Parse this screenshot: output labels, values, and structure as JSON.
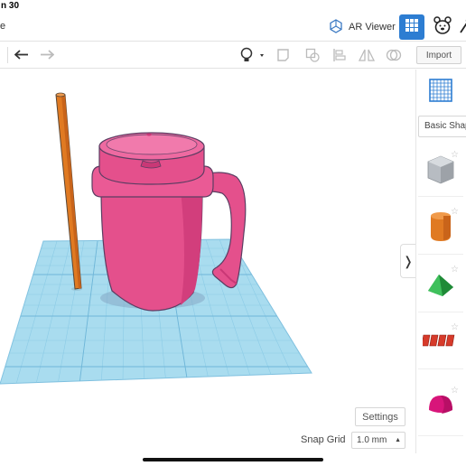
{
  "status_bar": {
    "time_fragment": "n 30"
  },
  "header": {
    "title_fragment": "e",
    "ar_viewer_label": "AR Viewer",
    "icons": [
      "cube-ar-icon",
      "grid-view-icon",
      "bear-icon",
      "tools-icon"
    ],
    "active_color": "#2d7dd2"
  },
  "toolbar": {
    "import_label": "Import",
    "icons": [
      "undo-icon",
      "redo-icon",
      "lightbulb-icon",
      "note-icon",
      "duplicate-icon",
      "align-icon",
      "mirror-icon",
      "group-icon"
    ]
  },
  "shapes_panel": {
    "category_label": "Basic Shap",
    "items": [
      "workplane",
      "box",
      "cylinder",
      "roof",
      "text",
      "half-sphere"
    ]
  },
  "scene": {
    "objects": [
      "mug",
      "rod"
    ],
    "mug_color": "#e4508c",
    "rod_color": "#e07a22",
    "workplane_color": "#a9dcef"
  },
  "footer": {
    "settings_label": "Settings",
    "snap_grid_label": "Snap Grid",
    "snap_grid_value": "1.0 mm"
  }
}
